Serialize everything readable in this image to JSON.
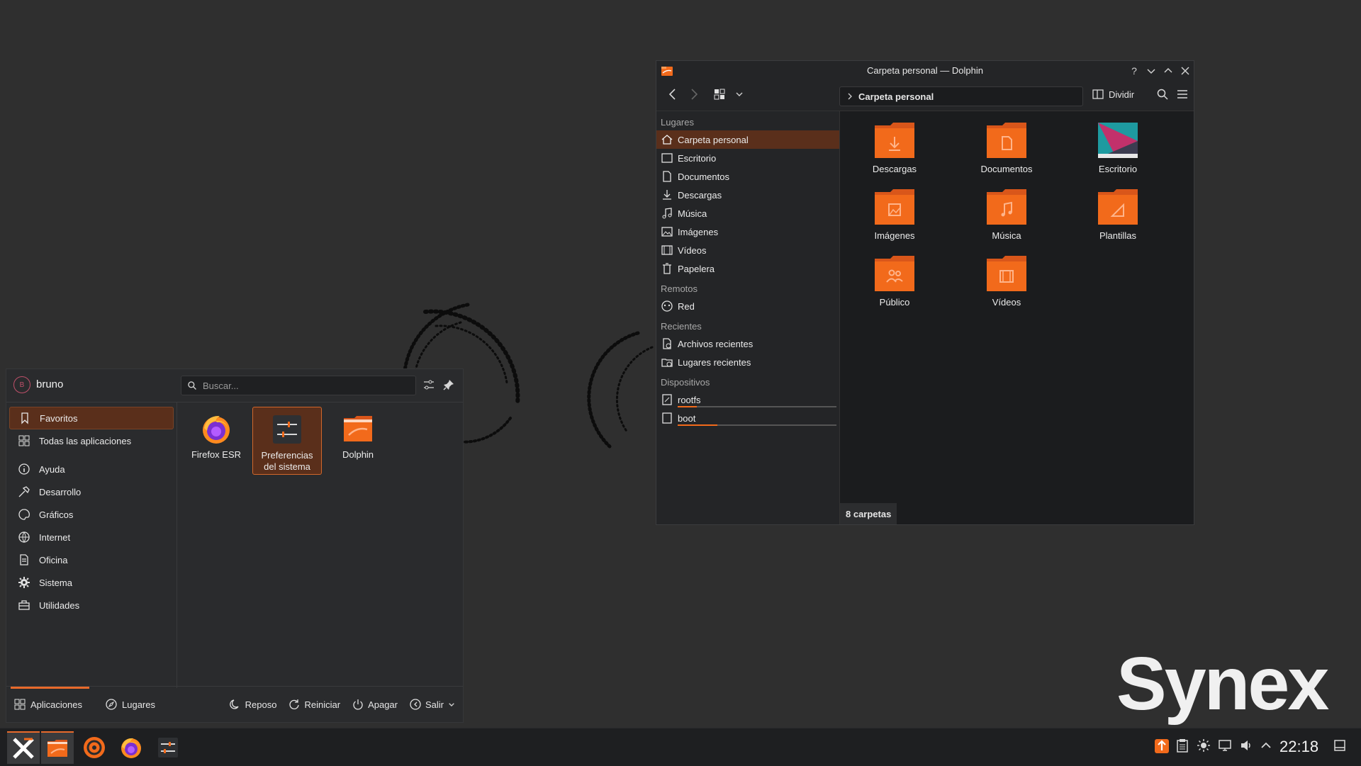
{
  "colors": {
    "accent": "#f26a1b",
    "folder": "#f26a1b",
    "highlight_bg": "#5a2f1b"
  },
  "wallpaper": {
    "logo_text": "Synex"
  },
  "dolphin": {
    "title": "Carpeta personal — Dolphin",
    "window_buttons": {
      "help": "?"
    },
    "breadcrumb": "Carpeta personal",
    "split_label": "Dividir",
    "places": {
      "sections": [
        {
          "title": "Lugares",
          "items": [
            {
              "label": "Carpeta personal",
              "icon": "home-icon"
            },
            {
              "label": "Escritorio",
              "icon": "desktop-icon"
            },
            {
              "label": "Documentos",
              "icon": "document-icon"
            },
            {
              "label": "Descargas",
              "icon": "download-icon"
            },
            {
              "label": "Música",
              "icon": "music-icon"
            },
            {
              "label": "Imágenes",
              "icon": "image-icon"
            },
            {
              "label": "Vídeos",
              "icon": "video-icon"
            },
            {
              "label": "Papelera",
              "icon": "trash-icon"
            }
          ]
        },
        {
          "title": "Remotos",
          "items": [
            {
              "label": "Red",
              "icon": "network-icon"
            }
          ]
        },
        {
          "title": "Recientes",
          "items": [
            {
              "label": "Archivos recientes",
              "icon": "recent-files-icon"
            },
            {
              "label": "Lugares recientes",
              "icon": "recent-places-icon"
            }
          ]
        },
        {
          "title": "Dispositivos",
          "items": [
            {
              "label": "rootfs",
              "icon": "drive-icon",
              "usage": 0.12
            },
            {
              "label": "boot",
              "icon": "drive-icon",
              "usage": 0.25
            }
          ]
        }
      ]
    },
    "folders": [
      {
        "label": "Descargas",
        "icon": "download-icon"
      },
      {
        "label": "Documentos",
        "icon": "document-icon"
      },
      {
        "label": "Escritorio",
        "icon": "desktop-wallpaper-icon"
      },
      {
        "label": "Imágenes",
        "icon": "image-icon"
      },
      {
        "label": "Música",
        "icon": "music-icon"
      },
      {
        "label": "Plantillas",
        "icon": "template-icon"
      },
      {
        "label": "Público",
        "icon": "users-icon"
      },
      {
        "label": "Vídeos",
        "icon": "video-icon"
      }
    ],
    "status": "8 carpetas"
  },
  "app_menu": {
    "avatar_initial": "B",
    "username": "bruno",
    "search_placeholder": "Buscar...",
    "categories": [
      {
        "label": "Favoritos",
        "icon": "bookmark-icon"
      },
      {
        "label": "Todas las aplicaciones",
        "icon": "grid-icon"
      },
      {
        "label": "Ayuda",
        "icon": "info-icon"
      },
      {
        "label": "Desarrollo",
        "icon": "hammer-icon"
      },
      {
        "label": "Gráficos",
        "icon": "palette-icon"
      },
      {
        "label": "Internet",
        "icon": "globe-icon"
      },
      {
        "label": "Oficina",
        "icon": "office-icon"
      },
      {
        "label": "Sistema",
        "icon": "gear-icon"
      },
      {
        "label": "Utilidades",
        "icon": "toolbox-icon"
      }
    ],
    "apps": [
      {
        "label": "Firefox ESR",
        "icon": "firefox-icon"
      },
      {
        "label": "Preferencias del sistema",
        "icon": "settings-icon"
      },
      {
        "label": "Dolphin",
        "icon": "dolphin-icon"
      }
    ],
    "footer": {
      "tabs": [
        {
          "label": "Aplicaciones",
          "icon": "grid-icon"
        },
        {
          "label": "Lugares",
          "icon": "compass-icon"
        }
      ],
      "actions": [
        {
          "label": "Reposo",
          "icon": "sleep-icon"
        },
        {
          "label": "Reiniciar",
          "icon": "restart-icon"
        },
        {
          "label": "Apagar",
          "icon": "power-icon"
        },
        {
          "label": "Salir",
          "icon": "logout-icon"
        }
      ]
    }
  },
  "taskbar": {
    "items": [
      {
        "name": "synex-launcher",
        "icon": "synex-logo-icon"
      },
      {
        "name": "dolphin",
        "icon": "dolphin-icon"
      },
      {
        "name": "software-center",
        "icon": "software-center-icon"
      },
      {
        "name": "firefox",
        "icon": "firefox-icon"
      },
      {
        "name": "system-settings",
        "icon": "settings-icon"
      }
    ],
    "tray": [
      "update-icon",
      "clipboard-icon",
      "brightness-icon",
      "display-icon",
      "volume-icon",
      "expand-tray-icon"
    ],
    "clock": "22:18"
  }
}
